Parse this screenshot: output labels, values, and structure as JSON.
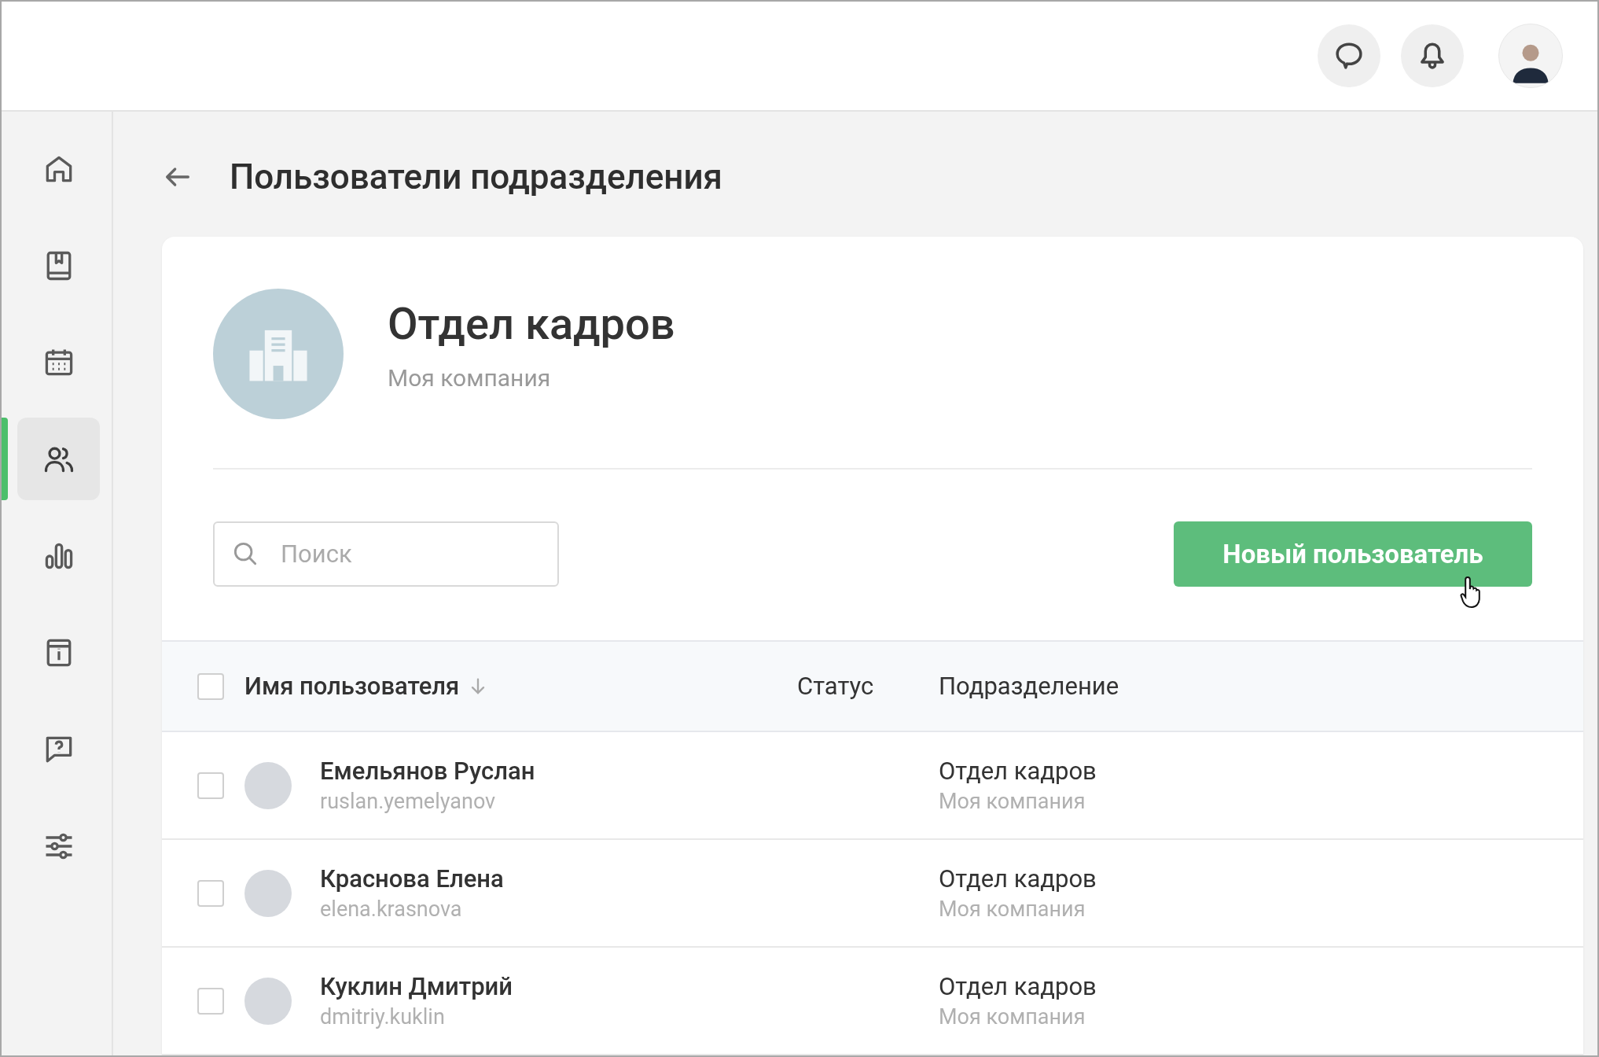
{
  "topbar": {
    "actions": [
      {
        "kind": "chat"
      },
      {
        "kind": "bell"
      }
    ]
  },
  "sidebar": {
    "items": [
      {
        "kind": "home",
        "selected": false
      },
      {
        "kind": "book",
        "selected": false
      },
      {
        "kind": "calendar",
        "selected": false
      },
      {
        "kind": "users",
        "selected": true
      },
      {
        "kind": "chart",
        "selected": false
      },
      {
        "kind": "info",
        "selected": false
      },
      {
        "kind": "help",
        "selected": false
      },
      {
        "kind": "sliders",
        "selected": false
      }
    ]
  },
  "page": {
    "title": "Пользователи подразделения"
  },
  "department": {
    "name": "Отдел кадров",
    "company": "Моя компания"
  },
  "search": {
    "placeholder": "Поиск"
  },
  "new_user_button": "Новый пользователь",
  "table": {
    "select_all_checked": false,
    "columns": [
      "Имя пользователя",
      "Статус",
      "Подразделение"
    ],
    "rows": [
      {
        "checked": false,
        "name": "Емельянов Руслан",
        "login": "ruslan.yemelyanov",
        "department": "Отдел кадров",
        "company": "Моя компания"
      },
      {
        "checked": false,
        "name": "Краснова Елена",
        "login": "elena.krasnova",
        "department": "Отдел кадров",
        "company": "Моя компания"
      },
      {
        "checked": false,
        "name": "Куклин Дмитрий",
        "login": "dmitriy.kuklin",
        "department": "Отдел кадров",
        "company": "Моя компания"
      }
    ]
  }
}
